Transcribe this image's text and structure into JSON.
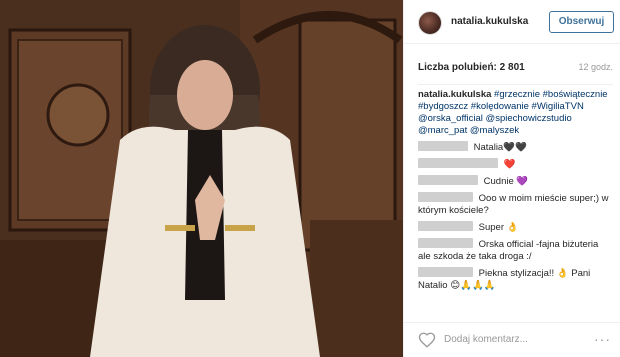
{
  "post": {
    "username": "natalia.kukulska",
    "follow_label": "Obserwuj",
    "likes": "Liczba polubień: 2 801",
    "time": "12 godz.",
    "caption_user": "natalia.kukulska",
    "caption_tags": "#grzecznie #boświątecznie #bydgoszcz #kolędowanie #WigiliaTVN @orska_official @spiechowiczstudio @marc_pat @malyszek"
  },
  "comments": [
    {
      "text": "Natalia🖤🖤"
    },
    {
      "text": "❤️"
    },
    {
      "text": "Cudnie 💜"
    },
    {
      "text": "Ooo w moim mieście super;) w którym kościele?"
    },
    {
      "text": "Super 👌"
    },
    {
      "text": "Orska official -fajna biżuteria ale szkoda że taka droga :/"
    },
    {
      "text": "Piekna stylizacja!! 👌 Pani Natalio 😊🙏🙏🙏"
    }
  ],
  "footer": {
    "add_comment_placeholder": "Dodaj komentarz...",
    "more_label": "···"
  },
  "colors": {
    "accent": "#3f729b",
    "link": "#003569"
  },
  "icons": [
    "heart-icon",
    "more-options-icon"
  ]
}
